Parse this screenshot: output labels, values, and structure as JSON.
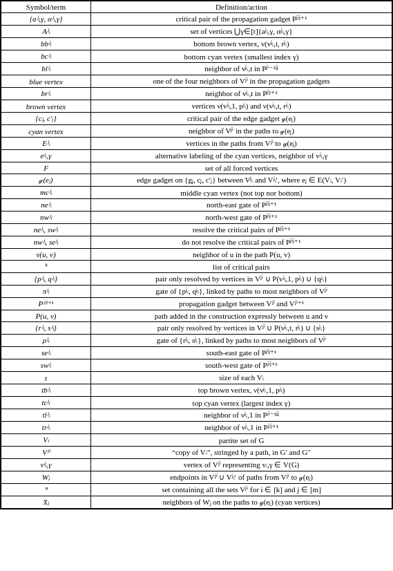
{
  "table": {
    "header": {
      "col1": "Symbol/term",
      "col2": "Definition/action"
    },
    "rows": [
      {
        "symbol": "{aʲᵢ,γ, αʲᵢ,γ}",
        "definition": "critical pair of the propagation gadget Pʲⁱʲ⁺¹"
      },
      {
        "symbol": "Aʲᵢ",
        "definition": "set of vertices ⋃γ∈[t]{aʲᵢ,γ, αʲᵢ,γ}"
      },
      {
        "symbol": "bbʲᵢ",
        "definition": "bottom brown vertex, ν(vʲᵢ,t, rʲᵢ)"
      },
      {
        "symbol": "bcʲᵢ",
        "definition": "bottom cyan vertex (smallest index γ)"
      },
      {
        "symbol": "blʲᵢ",
        "definition": "neighbor of vʲᵢ,t in Pʲⁱ⁻¹ʲʲ"
      },
      {
        "symbol": "blue vertex",
        "definition": "one of the four neighbors of Vʲⁱ in the propagation gadgets"
      },
      {
        "symbol": "brʲᵢ",
        "definition": "neighbor of vʲᵢ,t in Pʲⁱʲ⁺¹"
      },
      {
        "symbol": "brown vertex",
        "definition": "vertices ν(vʲᵢ,1, pʲᵢ) and ν(vʲᵢ,t, rʲᵢ)"
      },
      {
        "symbol": "{cⱼ, c′ⱼ}",
        "definition": "critical pair of the edge gadget ℊ(eⱼ)"
      },
      {
        "symbol": "cyan vertex",
        "definition": "neighbor of Vʲⁱ in the paths to ℊ(eⱼ)"
      },
      {
        "symbol": "Eʲᵢ",
        "definition": "vertices in the paths from Vʲⁱ to ℊ(eⱼ)"
      },
      {
        "symbol": "eʲᵢ,γ",
        "definition": "alternative labeling of the cyan vertices, neighbor of vʲᵢ,γ"
      },
      {
        "symbol": "F",
        "definition": "set of all forced vertices"
      },
      {
        "symbol": "ℊ(eⱼ)",
        "definition": "edge gadget on {gⱼ, cⱼ, c′ⱼ} between Vʲᵢ and Vʲᵢ′, where eⱼ ∈ E(Vᵢ, Vᵢ′)"
      },
      {
        "symbol": "mcʲᵢ",
        "definition": "middle cyan vertex (not top nor bottom)"
      },
      {
        "symbol": "neʲᵢ",
        "definition": "north-east gate of Pʲⁱʲ⁺¹"
      },
      {
        "symbol": "nwʲᵢ",
        "definition": "north-west gate of Pʲⁱʲ⁺¹"
      },
      {
        "symbol": "neʲᵢ, swʲᵢ",
        "definition": "resolve the critical pairs of Pʲⁱʲ⁺¹"
      },
      {
        "symbol": "nwʲᵢ, seʲᵢ",
        "definition": "do not resolve the critical pairs of Pʲⁱʲ⁺¹"
      },
      {
        "symbol": "ν(u, v)",
        "definition": "neighbor of u in the path P(u, v)"
      },
      {
        "symbol": "ᵏ",
        "definition": "list of critical pairs"
      },
      {
        "symbol": "{pʲᵢ, qʲᵢ}",
        "definition": "pair only resolved by vertices in Vʲⁱ ∪ P(vʲᵢ,1, pʲᵢ) ∪ {qʲᵢ}"
      },
      {
        "symbol": "πʲᵢ",
        "definition": "gate of {pʲᵢ, qʲᵢ}, linked by paths to most neighbors of Vʲⁱ"
      },
      {
        "symbol": "Pʲⁱʲ⁺¹",
        "definition": "propagation gadget between Vʲⁱ and Vʲⁱ⁺¹"
      },
      {
        "symbol": "P(u, v)",
        "definition": "path added in the construction expressly between u and v"
      },
      {
        "symbol": "{rʲᵢ, sʲᵢ}",
        "definition": "pair only resolved by vertices in Vʲⁱ ∪ P(vʲᵢ,t, rʲᵢ) ∪ {sʲᵢ}"
      },
      {
        "symbol": "ρʲᵢ",
        "definition": "gate of {rʲᵢ, sʲᵢ}, linked by paths to most neighbors of Vʲⁱ"
      },
      {
        "symbol": "seʲᵢ",
        "definition": "south-east gate of Pʲⁱʲ⁺¹"
      },
      {
        "symbol": "swʲᵢ",
        "definition": "south-west gate of Pʲⁱʲ⁺¹"
      },
      {
        "symbol": "t",
        "definition": "size of each Vᵢ"
      },
      {
        "symbol": "tbʲᵢ",
        "definition": "top brown vertex, ν(vʲᵢ,1, pʲᵢ)"
      },
      {
        "symbol": "tcʲᵢ",
        "definition": "top cyan vertex (largest index γ)"
      },
      {
        "symbol": "tlʲᵢ",
        "definition": "neighbor of vʲᵢ,1 in Pʲⁱ⁻¹ʲʲ"
      },
      {
        "symbol": "trʲᵢ",
        "definition": "neighbor of vʲᵢ,1 in Pʲⁱʲ⁺¹"
      },
      {
        "symbol": "Vᵢ",
        "definition": "partite set of G"
      },
      {
        "symbol": "Vʲⁱ",
        "definition": "“copy of Vᵢ”, stringed by a path, in G′ and G′′"
      },
      {
        "symbol": "vʲᵢ,γ",
        "definition": "vertex of Vʲⁱ representing vᵢ,γ ∈ V(G)"
      },
      {
        "symbol": "Wⱼ",
        "definition": "endpoints in Vʲⁱ ∪ Vʲᵢ′ of paths from Vʲⁱ to ℊ(eⱼ)"
      },
      {
        "symbol": "ᵊ",
        "definition": "set containing all the sets Vʲⁱ for i ∈ [k] and j ∈ [m]"
      },
      {
        "symbol": "Xⱼ",
        "definition": "neighbors of Wⱼ on the paths to ℊ(eⱼ) (cyan vertices)"
      }
    ]
  }
}
